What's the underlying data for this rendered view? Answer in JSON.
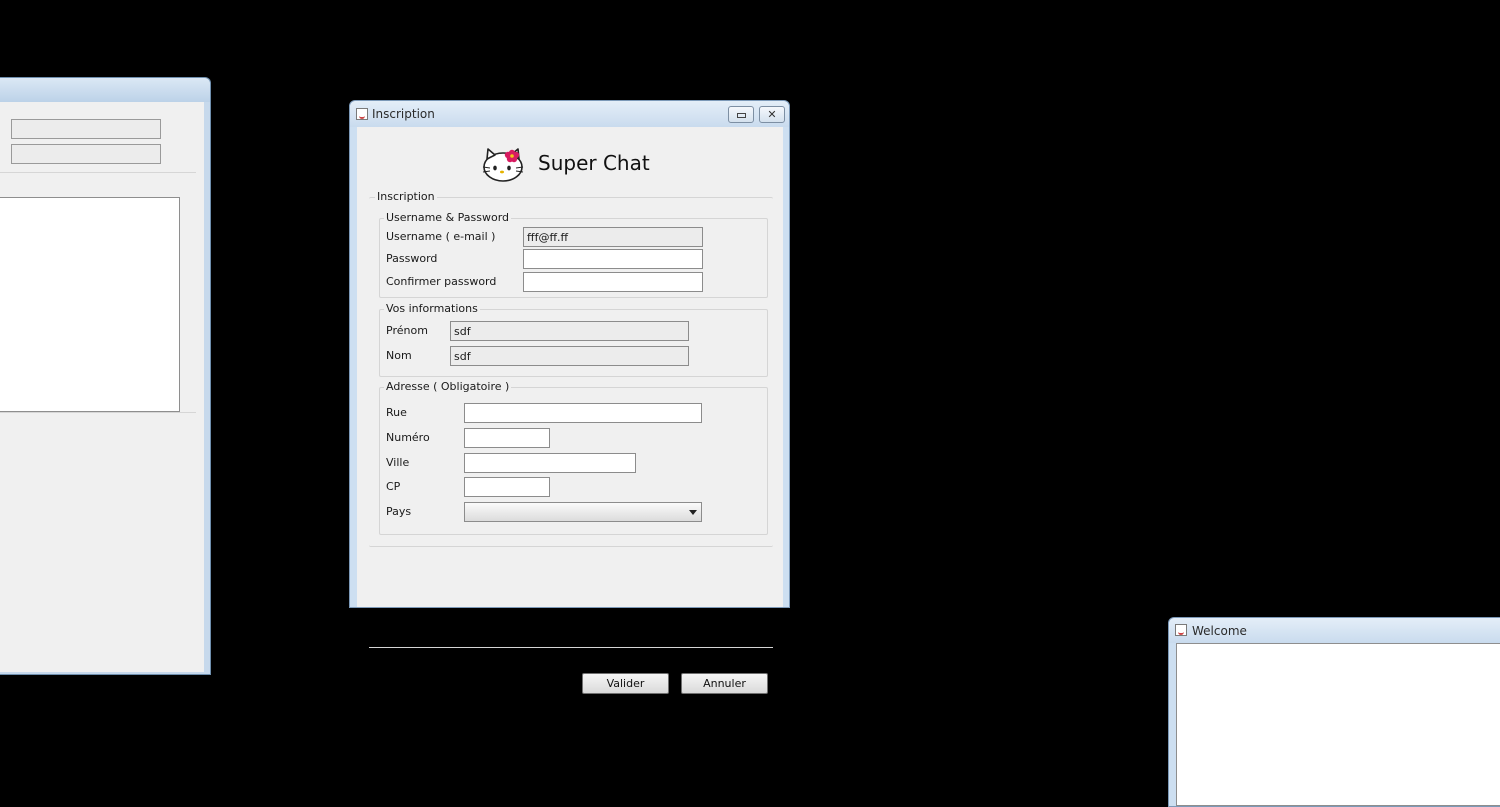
{
  "dialog": {
    "title": "Inscription",
    "app_title": "Super Chat",
    "logo_icon": "hello-kitty-logo",
    "section_label": "Inscription",
    "user_group": {
      "legend": "Username & Password",
      "username_label": "Username ( e-mail )",
      "username_value": "fff@ff.ff",
      "password_label": "Password",
      "password_value": "",
      "confirm_label": "Confirmer password",
      "confirm_value": ""
    },
    "info_group": {
      "legend": "Vos informations",
      "prenom_label": "Prénom",
      "prenom_value": "sdf",
      "nom_label": "Nom",
      "nom_value": "sdf"
    },
    "address_group": {
      "legend": "Adresse ( Obligatoire )",
      "rue_label": "Rue",
      "rue_value": "",
      "numero_label": "Numéro",
      "numero_value": "",
      "ville_label": "Ville",
      "ville_value": "",
      "cp_label": "CP",
      "cp_value": "",
      "pays_label": "Pays",
      "pays_value": ""
    },
    "buttons": {
      "validate": "Valider",
      "cancel": "Annuler"
    }
  },
  "welcome_window": {
    "title": "Welcome"
  },
  "colors": {
    "desktop": "#000000",
    "window_frame": "#cddff1",
    "client_bg": "#f0f0f0"
  }
}
